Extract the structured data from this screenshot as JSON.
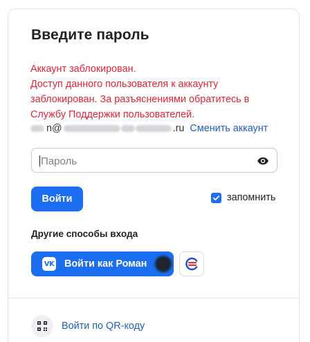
{
  "login": {
    "title": "Введите пароль",
    "error_lines": [
      "Аккаунт заблокирован.",
      "Доступ данного пользователя к аккаунту",
      "заблокирован. За разъяснениями обратитесь в",
      "Службу Поддержки пользователей."
    ],
    "account": {
      "visible_fragment_1": "n@",
      "visible_fragment_2": ".ru",
      "switch_label": "Сменить аккаунт"
    },
    "password": {
      "placeholder": "Пароль",
      "value": "",
      "eye_icon": "eye-icon"
    },
    "submit_label": "Войти",
    "remember": {
      "label": "запомнить",
      "checked": true
    },
    "other_methods": {
      "title": "Другие способы входа",
      "vk": {
        "logo_text": "VK",
        "label": "Войти как Роман"
      },
      "esia_icon": "esia-logo-icon"
    },
    "qr": {
      "label": "Войти по QR-коду",
      "icon": "qr-code-icon"
    }
  },
  "colors": {
    "accent": "#1a6eef",
    "link": "#1f5fbf",
    "error": "#e0243a",
    "border": "#c5c8cc"
  }
}
